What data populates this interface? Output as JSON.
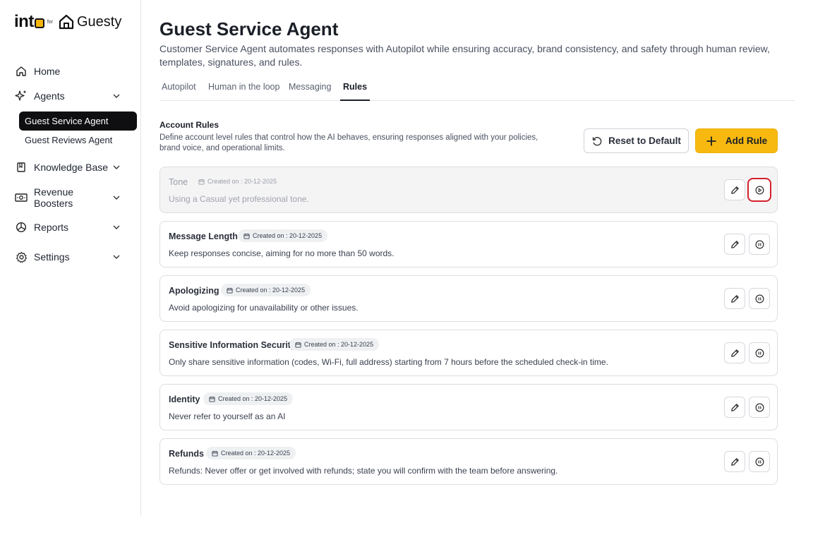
{
  "brand": {
    "into": "int",
    "for": "for",
    "guesty": "Guesty"
  },
  "nav": {
    "home": "Home",
    "agents": "Agents",
    "sub": [
      "Guest Service Agent",
      "Guest Reviews Agent"
    ],
    "knowledge_base": "Knowledge Base",
    "revenue_boosters": "Revenue Boosters",
    "reports": "Reports",
    "settings": "Settings"
  },
  "page": {
    "title": "Guest Service Agent",
    "description": "Customer Service Agent automates responses with Autopilot while ensuring accuracy, brand consistency, and safety through human review, templates, signatures, and rules."
  },
  "tabs": [
    "Autopilot",
    "Human in the loop",
    "Messaging",
    "Rules"
  ],
  "active_tab": "Rules",
  "section": {
    "title": "Account Rules",
    "description": "Define account level rules that control how the AI behaves, ensuring responses aligned with your policies, brand voice, and operational limits.",
    "reset_label": "Reset to Default",
    "add_label": "Add Rule"
  },
  "rules": [
    {
      "name": "Tone",
      "date": "Created on : 20-12-2025",
      "text": "Using a Casual yet professional tone.",
      "status": "paused"
    },
    {
      "name": "Message Length",
      "date": "Created on : 20-12-2025",
      "text": "Keep responses concise, aiming for no more than 50 words.",
      "status": "active"
    },
    {
      "name": "Apologizing",
      "date": "Created on : 20-12-2025",
      "text": "Avoid apologizing for unavailability or other issues.",
      "status": "active"
    },
    {
      "name": "Sensitive Information Security",
      "date": "Created on : 20-12-2025",
      "text": "Only share sensitive information (codes, Wi-Fi, full address) starting from 7 hours before the scheduled check-in time.",
      "status": "active"
    },
    {
      "name": "Identity",
      "date": "Created on : 20-12-2025",
      "text": "Never refer to yourself as an AI",
      "status": "active"
    },
    {
      "name": "Refunds",
      "date": "Created on : 20-12-2025",
      "text": "Refunds: Never offer or get involved with refunds; state you will confirm with the team before answering.",
      "status": "active"
    }
  ],
  "colors": {
    "accent": "#f7b90f",
    "active_nav": "#0f0f12",
    "highlight": "#d4212b"
  }
}
